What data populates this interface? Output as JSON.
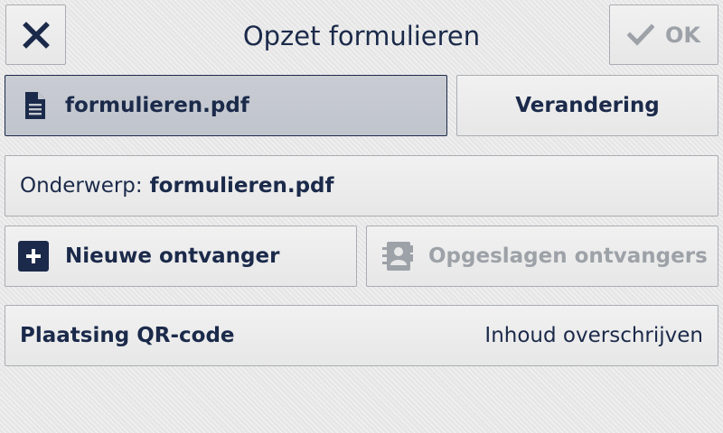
{
  "header": {
    "title": "Opzet formulieren",
    "ok_label": "OK"
  },
  "file": {
    "name": "formulieren.pdf"
  },
  "change": {
    "label": "Verandering"
  },
  "subject": {
    "label": "Onderwerp:",
    "value": "formulieren.pdf"
  },
  "recipients": {
    "new_label": "Nieuwe ontvanger",
    "saved_label": "Opgeslagen ontvangers"
  },
  "qr": {
    "label": "Plaatsing QR-code",
    "value": "Inhoud overschrijven"
  },
  "icons": {
    "close": "close-icon",
    "ok": "checkmark-icon",
    "file": "document-icon",
    "new_recipient": "plus-icon",
    "saved_recipients": "address-book-icon"
  },
  "colors": {
    "text": "#1b2a4a",
    "disabled_text": "#9da2a8",
    "selected_background": "#c4c8cf"
  }
}
